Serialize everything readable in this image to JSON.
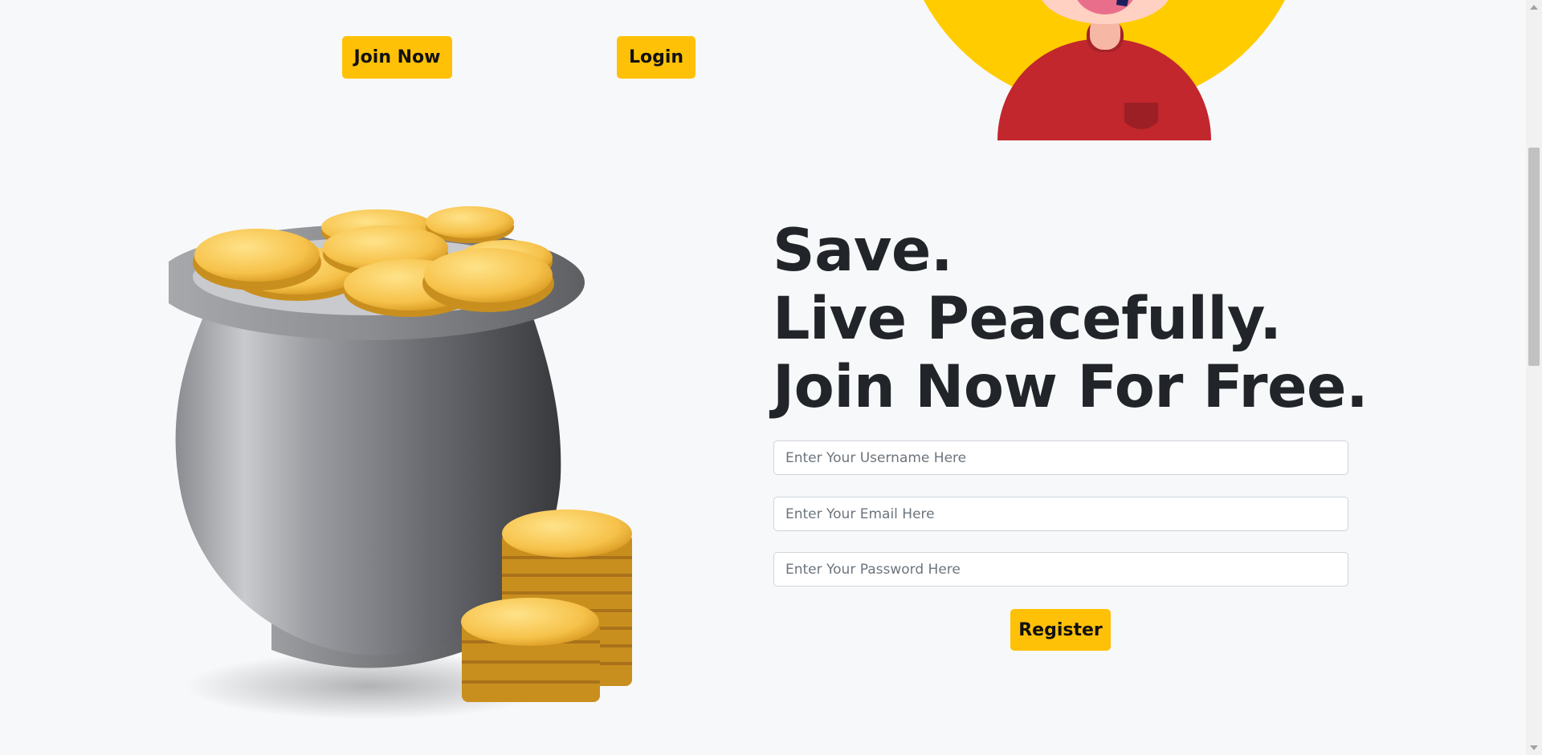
{
  "nav": {
    "join_label": "Join Now",
    "login_label": "Login"
  },
  "hero": {
    "lines": [
      "Save.",
      "Live Peacefully.",
      "Join Now For Free."
    ]
  },
  "form": {
    "username_placeholder": "Enter Your Username Here",
    "email_placeholder": "Enter Your Email Here",
    "password_placeholder": "Enter Your Password Here",
    "register_label": "Register"
  },
  "colors": {
    "accent": "#ffc107",
    "background": "#f7f8fa",
    "text": "#212529"
  },
  "icons": {
    "avatar": "person-avatar-illustration",
    "pot": "pot-of-gold-coins-illustration"
  }
}
